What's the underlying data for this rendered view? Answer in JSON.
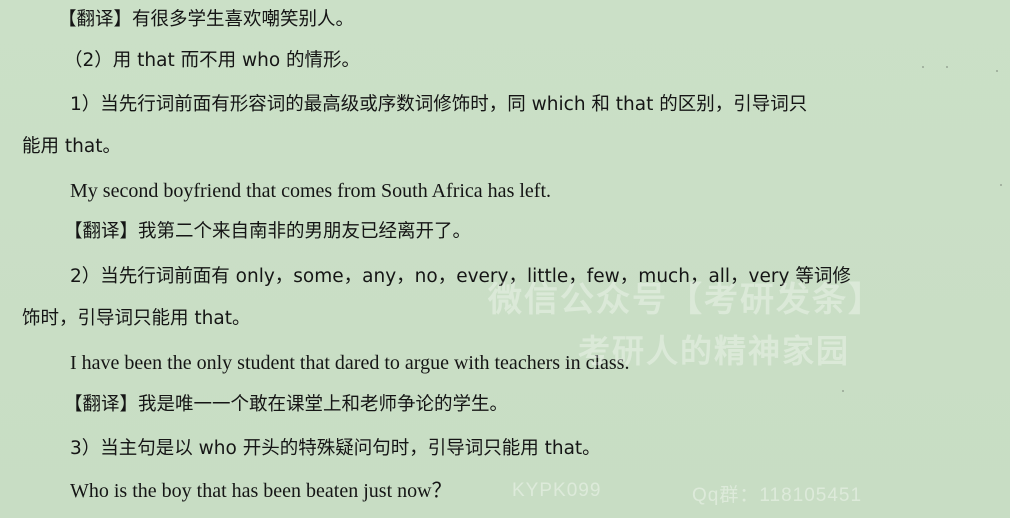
{
  "lines": [
    "【翻译】有很多学生喜欢嘲笑别人。",
    "（2）用 that 而不用 who 的情形。",
    "1）当先行词前面有形容词的最高级或序数词修饰时，同 which 和 that 的区别，引导词只",
    "能用 that。",
    "My second boyfriend that comes from South Africa has left.",
    "【翻译】我第二个来自南非的男朋友已经离开了。",
    "2）当先行词前面有 only，some，any，no，every，little，few，much，all，very 等词修",
    "饰时，引导词只能用 that。",
    "I have been the only student that dared to argue with teachers in class.",
    "【翻译】我是唯一一个敢在课堂上和老师争论的学生。",
    "3）当主句是以 who 开头的特殊疑问句时，引导词只能用 that。",
    "Who is the boy that has been beaten just now？"
  ],
  "watermark": {
    "line1": "微信公众号【考研发条】",
    "line2": "考研人的精神家园",
    "kypk": "KYPK099",
    "qq": "Qq群：118105451"
  }
}
